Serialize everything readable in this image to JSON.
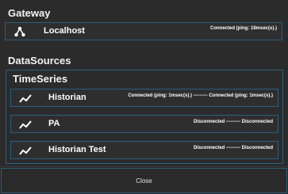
{
  "gateway": {
    "title": "Gateway",
    "item": {
      "name": "Localhost",
      "icon": "network-hub-icon",
      "status": "Connected (ping: 18msec(s).)"
    }
  },
  "datasources": {
    "title": "DataSources",
    "timeseries": {
      "title": "TimeSeries",
      "items": [
        {
          "name": "Historian",
          "icon": "trend-line-icon",
          "status": "Connected (ping: 1msec(s).) --------- Connected (ping: 1msec(s).)"
        },
        {
          "name": "PA",
          "icon": "trend-line-icon",
          "status": "Disconnected --------- Disconnected"
        },
        {
          "name": "Historian Test",
          "icon": "trend-line-icon",
          "status": "Disconnected --------- Disconnected"
        }
      ]
    }
  },
  "footer": {
    "close_label": "Close"
  },
  "colors": {
    "background": "#2b2b2b",
    "border_accent": "#2a5f7e"
  }
}
